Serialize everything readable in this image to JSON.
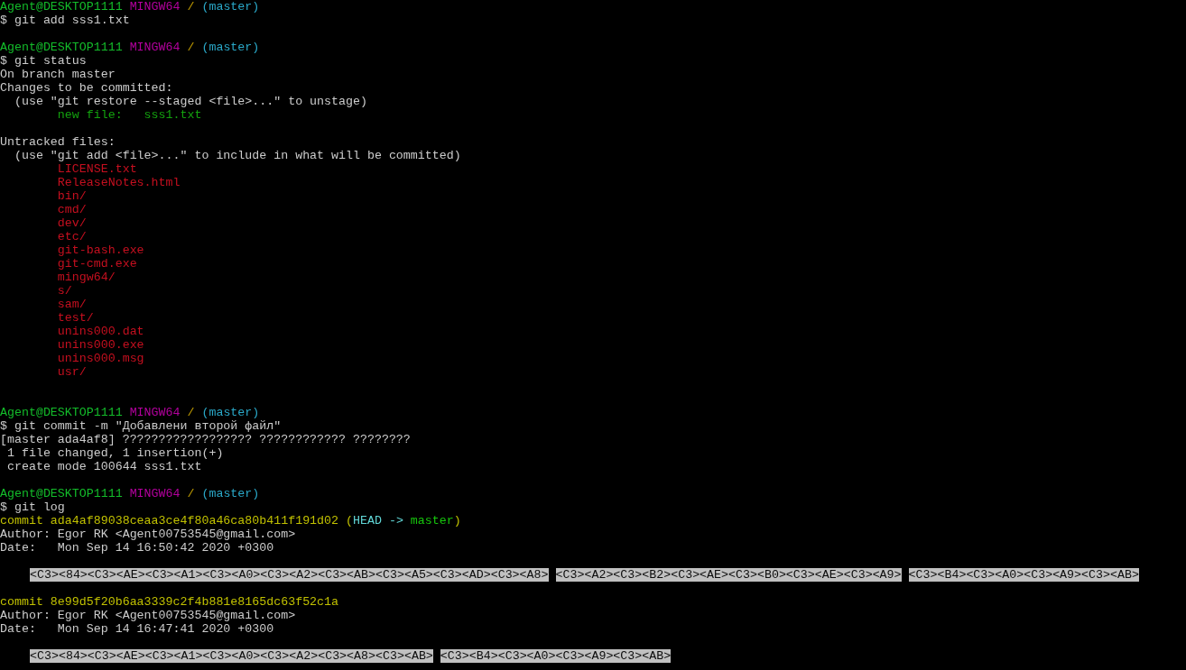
{
  "terminal": {
    "lines": [
      {
        "kind": "text",
        "segments": [
          {
            "kind": "user",
            "text": "Agent@DESKTOP1111"
          },
          {
            "kind": "system",
            "text": " MINGW64"
          },
          {
            "kind": "path",
            "text": " /"
          },
          {
            "kind": "branch",
            "text": " (master)"
          }
        ]
      },
      {
        "kind": "text",
        "segments": [
          {
            "kind": "command",
            "text": "$ git add sss1.txt"
          }
        ]
      },
      {
        "kind": "blank"
      },
      {
        "kind": "text",
        "segments": [
          {
            "kind": "user",
            "text": "Agent@DESKTOP1111"
          },
          {
            "kind": "system",
            "text": " MINGW64"
          },
          {
            "kind": "path",
            "text": " /"
          },
          {
            "kind": "branch",
            "text": " (master)"
          }
        ]
      },
      {
        "kind": "text",
        "segments": [
          {
            "kind": "command",
            "text": "$ git status"
          }
        ]
      },
      {
        "kind": "text",
        "segments": [
          {
            "kind": "output",
            "text": "On branch master"
          }
        ]
      },
      {
        "kind": "text",
        "segments": [
          {
            "kind": "output",
            "text": "Changes to be committed:"
          }
        ]
      },
      {
        "kind": "text",
        "segments": [
          {
            "kind": "output",
            "text": "  (use \"git restore --staged <file>...\" to unstage)"
          }
        ]
      },
      {
        "kind": "text",
        "segments": [
          {
            "kind": "staged",
            "text": "        new file:   sss1.txt"
          }
        ]
      },
      {
        "kind": "blank"
      },
      {
        "kind": "text",
        "segments": [
          {
            "kind": "output",
            "text": "Untracked files:"
          }
        ]
      },
      {
        "kind": "text",
        "segments": [
          {
            "kind": "output",
            "text": "  (use \"git add <file>...\" to include in what will be committed)"
          }
        ]
      },
      {
        "kind": "text",
        "segments": [
          {
            "kind": "untracked",
            "text": "        LICENSE.txt"
          }
        ]
      },
      {
        "kind": "text",
        "segments": [
          {
            "kind": "untracked",
            "text": "        ReleaseNotes.html"
          }
        ]
      },
      {
        "kind": "text",
        "segments": [
          {
            "kind": "untracked",
            "text": "        bin/"
          }
        ]
      },
      {
        "kind": "text",
        "segments": [
          {
            "kind": "untracked",
            "text": "        cmd/"
          }
        ]
      },
      {
        "kind": "text",
        "segments": [
          {
            "kind": "untracked",
            "text": "        dev/"
          }
        ]
      },
      {
        "kind": "text",
        "segments": [
          {
            "kind": "untracked",
            "text": "        etc/"
          }
        ]
      },
      {
        "kind": "text",
        "segments": [
          {
            "kind": "untracked",
            "text": "        git-bash.exe"
          }
        ]
      },
      {
        "kind": "text",
        "segments": [
          {
            "kind": "untracked",
            "text": "        git-cmd.exe"
          }
        ]
      },
      {
        "kind": "text",
        "segments": [
          {
            "kind": "untracked",
            "text": "        mingw64/"
          }
        ]
      },
      {
        "kind": "text",
        "segments": [
          {
            "kind": "untracked",
            "text": "        s/"
          }
        ]
      },
      {
        "kind": "text",
        "segments": [
          {
            "kind": "untracked",
            "text": "        sam/"
          }
        ]
      },
      {
        "kind": "text",
        "segments": [
          {
            "kind": "untracked",
            "text": "        test/"
          }
        ]
      },
      {
        "kind": "text",
        "segments": [
          {
            "kind": "untracked",
            "text": "        unins000.dat"
          }
        ]
      },
      {
        "kind": "text",
        "segments": [
          {
            "kind": "untracked",
            "text": "        unins000.exe"
          }
        ]
      },
      {
        "kind": "text",
        "segments": [
          {
            "kind": "untracked",
            "text": "        unins000.msg"
          }
        ]
      },
      {
        "kind": "text",
        "segments": [
          {
            "kind": "untracked",
            "text": "        usr/"
          }
        ]
      },
      {
        "kind": "blank"
      },
      {
        "kind": "blank"
      },
      {
        "kind": "text",
        "segments": [
          {
            "kind": "user",
            "text": "Agent@DESKTOP1111"
          },
          {
            "kind": "system",
            "text": " MINGW64"
          },
          {
            "kind": "path",
            "text": " /"
          },
          {
            "kind": "branch",
            "text": " (master)"
          }
        ]
      },
      {
        "kind": "text",
        "segments": [
          {
            "kind": "command",
            "text": "$ git commit -m \"Добавлени второй файл\""
          }
        ]
      },
      {
        "kind": "text",
        "segments": [
          {
            "kind": "output",
            "text": "[master ada4af8] ?????????????????? ???????????? ????????"
          }
        ]
      },
      {
        "kind": "text",
        "segments": [
          {
            "kind": "output",
            "text": " 1 file changed, 1 insertion(+)"
          }
        ]
      },
      {
        "kind": "text",
        "segments": [
          {
            "kind": "output",
            "text": " create mode 100644 sss1.txt"
          }
        ]
      },
      {
        "kind": "blank"
      },
      {
        "kind": "text",
        "segments": [
          {
            "kind": "user",
            "text": "Agent@DESKTOP1111"
          },
          {
            "kind": "system",
            "text": " MINGW64"
          },
          {
            "kind": "path",
            "text": " /"
          },
          {
            "kind": "branch",
            "text": " (master)"
          }
        ]
      },
      {
        "kind": "text",
        "segments": [
          {
            "kind": "command",
            "text": "$ git log"
          }
        ]
      },
      {
        "kind": "text",
        "segments": [
          {
            "kind": "commit",
            "text": "commit ada4af89038ceaa3ce4f80a46ca80b411f191d02 ("
          },
          {
            "kind": "head",
            "text": "HEAD -> "
          },
          {
            "kind": "ref",
            "text": "master"
          },
          {
            "kind": "commit",
            "text": ")"
          }
        ]
      },
      {
        "kind": "text",
        "segments": [
          {
            "kind": "output",
            "text": "Author: Egor RK <Agent00753545@gmail.com>"
          }
        ]
      },
      {
        "kind": "text",
        "segments": [
          {
            "kind": "output",
            "text": "Date:   Mon Sep 14 16:50:42 2020 +0300"
          }
        ]
      },
      {
        "kind": "blank"
      },
      {
        "kind": "bytes",
        "segments": [
          {
            "kind": "escaped",
            "text": "<C3><84><C3><AE><C3><A1><C3><A0><C3><A2><C3><AB><C3><A5><C3><AD><C3><A8>"
          },
          {
            "kind": "escaped",
            "text": "<C3><A2><C3><B2><C3><AE><C3><B0><C3><AE><C3><A9>"
          },
          {
            "kind": "escaped",
            "text": "<C3><B4><C3><A0><C3><A9><C3><AB>"
          }
        ]
      },
      {
        "kind": "blank"
      },
      {
        "kind": "text",
        "segments": [
          {
            "kind": "commit",
            "text": "commit 8e99d5f20b6aa3339c2f4b881e8165dc63f52c1a"
          }
        ]
      },
      {
        "kind": "text",
        "segments": [
          {
            "kind": "output",
            "text": "Author: Egor RK <Agent00753545@gmail.com>"
          }
        ]
      },
      {
        "kind": "text",
        "segments": [
          {
            "kind": "output",
            "text": "Date:   Mon Sep 14 16:47:41 2020 +0300"
          }
        ]
      },
      {
        "kind": "blank"
      },
      {
        "kind": "bytes",
        "segments": [
          {
            "kind": "escaped",
            "text": "<C3><84><C3><AE><C3><A1><C3><A0><C3><A2><C3><A8><C3><AB>"
          },
          {
            "kind": "escaped",
            "text": "<C3><B4><C3><A0><C3><A9><C3><AB>"
          }
        ]
      }
    ]
  }
}
